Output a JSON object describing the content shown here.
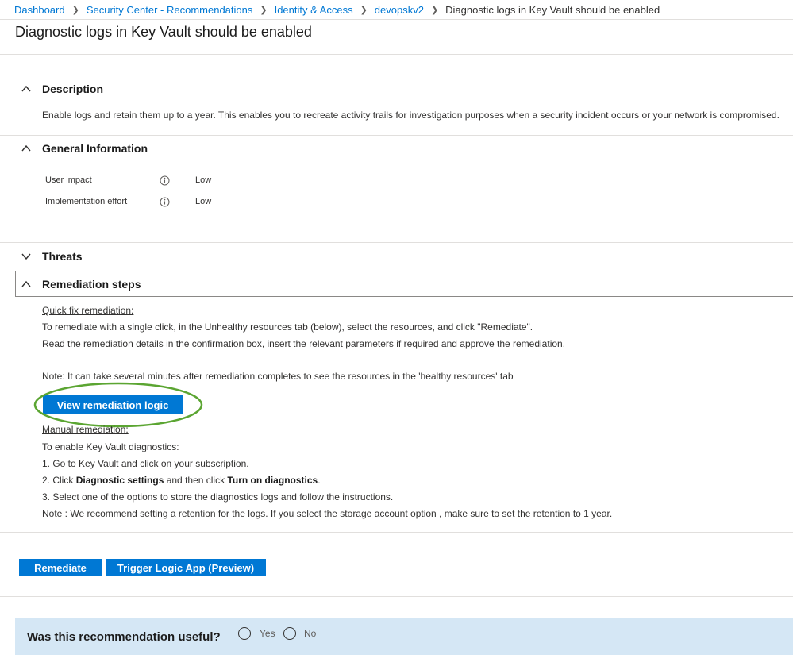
{
  "breadcrumb": [
    {
      "label": "Dashboard",
      "link": true
    },
    {
      "label": "Security Center - Recommendations",
      "link": true
    },
    {
      "label": "Identity & Access",
      "link": true
    },
    {
      "label": "devopskv2",
      "link": true
    },
    {
      "label": "Diagnostic logs in Key Vault should be enabled",
      "link": false
    }
  ],
  "page_title": "Diagnostic logs in Key Vault should be enabled",
  "description": {
    "header": "Description",
    "text": "Enable logs and retain them up to a year. This enables you to recreate activity trails for investigation purposes when a security incident occurs or your network is compromised."
  },
  "general_info": {
    "header": "General Information",
    "rows": [
      {
        "label": "User impact",
        "value": "Low"
      },
      {
        "label": "Implementation effort",
        "value": "Low"
      }
    ]
  },
  "threats": {
    "header": "Threats"
  },
  "remediation": {
    "header": "Remediation steps",
    "quick_fix_title": "Quick fix remediation:",
    "quick_fix_line1": "To remediate with a single click, in the Unhealthy resources tab (below), select the resources, and click \"Remediate\".",
    "quick_fix_line2": "Read the remediation details in the confirmation box, insert the relevant parameters if required and approve the remediation.",
    "note": "Note: It can take several minutes after remediation completes to see the resources in the 'healthy resources' tab",
    "view_logic_button": "View remediation logic",
    "manual_title": "Manual remediation:",
    "manual_intro": "To enable Key Vault diagnostics:",
    "step1": "1. Go to Key Vault and click on your subscription.",
    "step2_a": "2. Click ",
    "step2_b": "Diagnostic settings",
    "step2_c": " and then click ",
    "step2_d": "Turn on diagnostics",
    "step2_e": ".",
    "step3": "3. Select one of the options to store the diagnostics logs and follow the instructions.",
    "note2": "Note : We recommend setting a retention for the logs. If you select the storage account option , make sure to set the retention to 1 year."
  },
  "actions": {
    "remediate": "Remediate",
    "trigger_logic_app": "Trigger Logic App (Preview)"
  },
  "feedback": {
    "question": "Was this recommendation useful?",
    "yes": "Yes",
    "no": "No"
  },
  "colors": {
    "accent": "#0078d4",
    "highlight_ellipse": "#5ba532",
    "feedback_bg": "#d5e7f5"
  },
  "icons": {
    "chevron_up": "chevron-up-icon",
    "chevron_down": "chevron-down-icon",
    "info": "info-icon",
    "breadcrumb_separator": "chevron-right-icon"
  }
}
